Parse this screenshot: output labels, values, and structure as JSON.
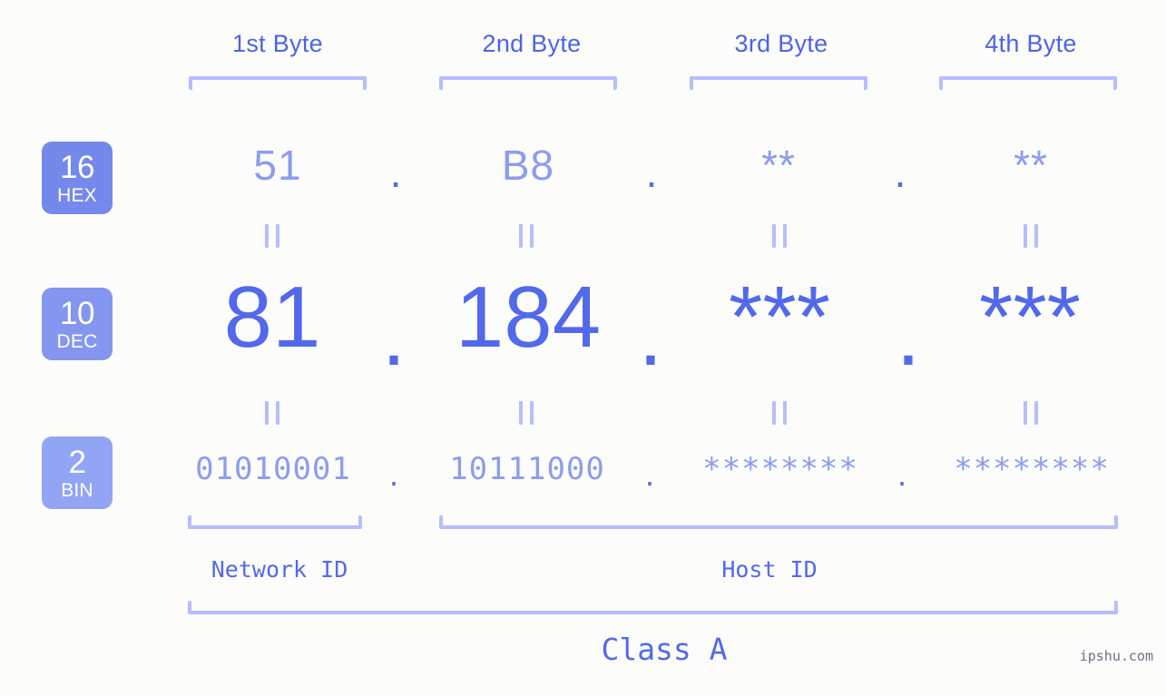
{
  "meta": {
    "background_color": "#fcfdfa",
    "accent_strong": "#5269ec",
    "accent_light": "#8c9cf0",
    "bracket_color": "#b6beff",
    "header_color": "#4d63e8"
  },
  "byte_headers": [
    {
      "label": "1st Byte"
    },
    {
      "label": "2nd Byte"
    },
    {
      "label": "3rd Byte"
    },
    {
      "label": "4th Byte"
    }
  ],
  "bases": [
    {
      "number": "16",
      "name": "HEX",
      "color": "#7588ec"
    },
    {
      "number": "10",
      "name": "DEC",
      "color": "#8496f0"
    },
    {
      "number": "2",
      "name": "BIN",
      "color": "#92a4f4"
    }
  ],
  "rows": {
    "hex": {
      "base_number": "16",
      "base_name": "HEX",
      "values": [
        "51",
        "B8",
        "**",
        "**"
      ],
      "separator": "."
    },
    "dec": {
      "base_number": "10",
      "base_name": "DEC",
      "values": [
        "81",
        "184",
        "***",
        "***"
      ],
      "separator": "."
    },
    "bin": {
      "base_number": "2",
      "base_name": "BIN",
      "values": [
        "01010001",
        "10111000",
        "********",
        "********"
      ],
      "separator": "."
    }
  },
  "equals_marks": {
    "glyph": "||",
    "count_per_gap": 4
  },
  "segments": {
    "network_id": "Network ID",
    "host_id": "Host ID",
    "class": "Class A"
  },
  "watermark": "ipshu.com"
}
